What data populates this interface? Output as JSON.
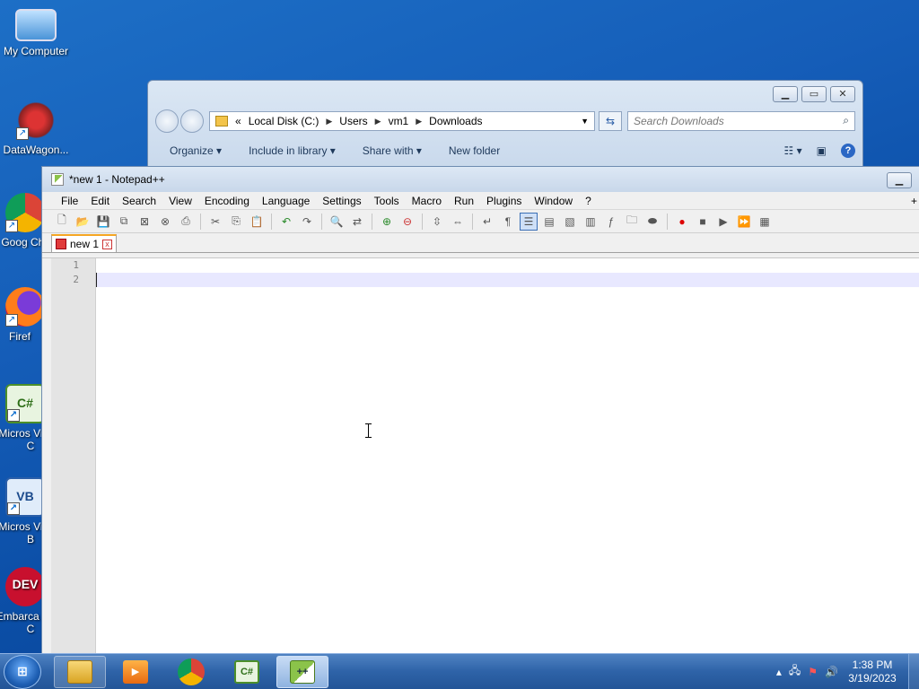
{
  "desktop": {
    "icons": [
      {
        "label": "My Computer"
      },
      {
        "label": "DataWagon..."
      },
      {
        "label": "Goog Chron"
      },
      {
        "label": "Firef"
      },
      {
        "label": "Micros Visual C"
      },
      {
        "label": "Micros Visual B"
      },
      {
        "label": "Embarca Dev-C"
      }
    ]
  },
  "explorer": {
    "address": {
      "prefix": "«",
      "parts": [
        "Local Disk (C:)",
        "Users",
        "vm1",
        "Downloads"
      ]
    },
    "search_placeholder": "Search Downloads",
    "commands": {
      "organize": "Organize",
      "include_in_library": "Include in library",
      "share_with": "Share with",
      "new_folder": "New folder"
    },
    "help": "?"
  },
  "notepad": {
    "title": "*new 1 - Notepad++",
    "menu": [
      "File",
      "Edit",
      "Search",
      "View",
      "Encoding",
      "Language",
      "Settings",
      "Tools",
      "Macro",
      "Run",
      "Plugins",
      "Window",
      "?"
    ],
    "menu_plus": "+",
    "tab": {
      "label": "new 1",
      "close": "x"
    },
    "line_numbers": [
      "1",
      "2"
    ]
  },
  "taskbar": {
    "clock": {
      "time": "1:38 PM",
      "date": "3/19/2023"
    },
    "apps": [
      "explorer",
      "media-player",
      "chrome",
      "visual-csharp",
      "notepad-plus-plus"
    ]
  }
}
